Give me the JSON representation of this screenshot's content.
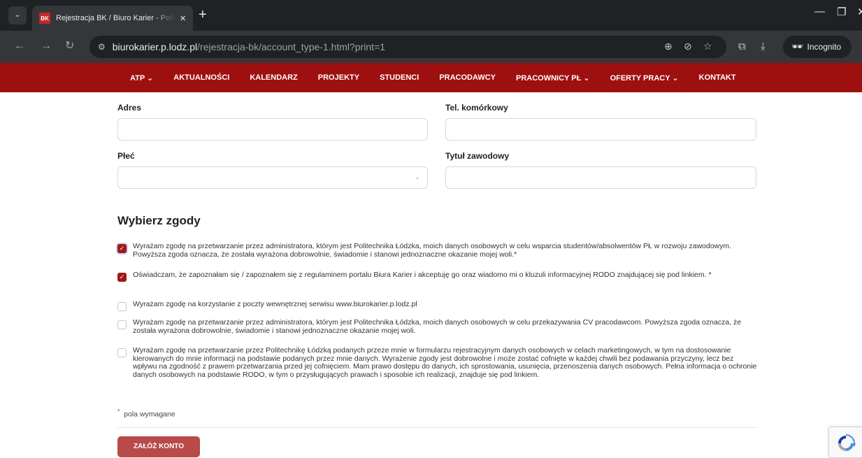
{
  "browser": {
    "tab_title": "Rejestracja BK / Biuro Karier - Politechnika Łódzka",
    "favicon_text": "BK",
    "url_host": "biurokarier.p.lodz.pl",
    "url_path": "/rejestracja-bk/account_type-1.html?print=1",
    "incognito_label": "Incognito"
  },
  "nav": {
    "items": [
      "ATP ⌄",
      "AKTUALNOŚCI",
      "KALENDARZ",
      "PROJEKTY",
      "STUDENCI",
      "PRACODAWCY",
      "PRACOWNICY PŁ ⌄",
      "OFERTY PRACY ⌄",
      "KONTAKT"
    ]
  },
  "form": {
    "adres_label": "Adres",
    "tel_label": "Tel. komórkowy",
    "plec_label": "Płeć",
    "tytul_label": "Tytuł zawodowy",
    "adres_value": "",
    "tel_value": "",
    "plec_value": "",
    "tytul_value": ""
  },
  "consents": {
    "title": "Wybierz zgody",
    "items": [
      {
        "checked": true,
        "text": "Wyrażam zgodę na przetwarzanie przez administratora, którym jest Politechnika Łódzka, moich danych osobowych w celu wsparcia studentów/absolwentów PŁ w rozwoju zawodowym. Powyższa zgoda oznacza, że została wyrażona dobrowolnie, świadomie i stanowi jednoznaczne okazanie mojej woli.*"
      },
      {
        "checked": true,
        "text": "Oświadczam, że zapoznałam się / zapoznałem się z regulaminem portalu Biura Karier i akceptuję go oraz wiadomo mi o kluzuli informacyjnej RODO znajdującej się pod linkiem. *"
      },
      {
        "checked": false,
        "text": "Wyrażam zgodę na korzystanie z poczty wewnętrznej serwisu www.biurokarier.p.lodz.pl"
      },
      {
        "checked": false,
        "text": "Wyrażam zgodę na przetwarzanie przez administratora, którym jest Politechnika Łódzka, moich danych osobowych w celu przekazywania CV pracodawcom. Powyższa zgoda oznacza, że została wyrażona dobrowolnie, świadomie i stanowi jednoznaczne okazanie mojej woli."
      },
      {
        "checked": false,
        "text": "Wyrażam zgodę na przetwarzanie przez Politechnikę Łódzką podanych przeze mnie w formularzu rejestracyjnym danych osobowych w celach marketingowych, w tym na dostosowanie kierowanych do mnie informacji na podstawie podanych przez mnie danych. Wyrażenie zgody jest dobrowolne i może zostać cofnięte w każdej chwili bez podawania przyczyny, lecz bez wpływu na zgodność z prawem przetwarzania przed jej cofnięciem. Mam prawo dostępu do danych, ich sprostowania, usunięcia, przenoszenia danych osobowych. Pełna informacja o ochronie danych osobowych na podstawie RODO, w tym o przysługujących prawach i sposobie ich realizacji, znajduje się pod linkiem."
      }
    ]
  },
  "required_note": {
    "star": "*",
    "text": "pola wymagane"
  },
  "submit_label": "ZAŁÓŻ KONTO",
  "colors": {
    "brand": "#9e1010",
    "button": "#b84a4a",
    "checkbox": "#9e1a1a"
  }
}
